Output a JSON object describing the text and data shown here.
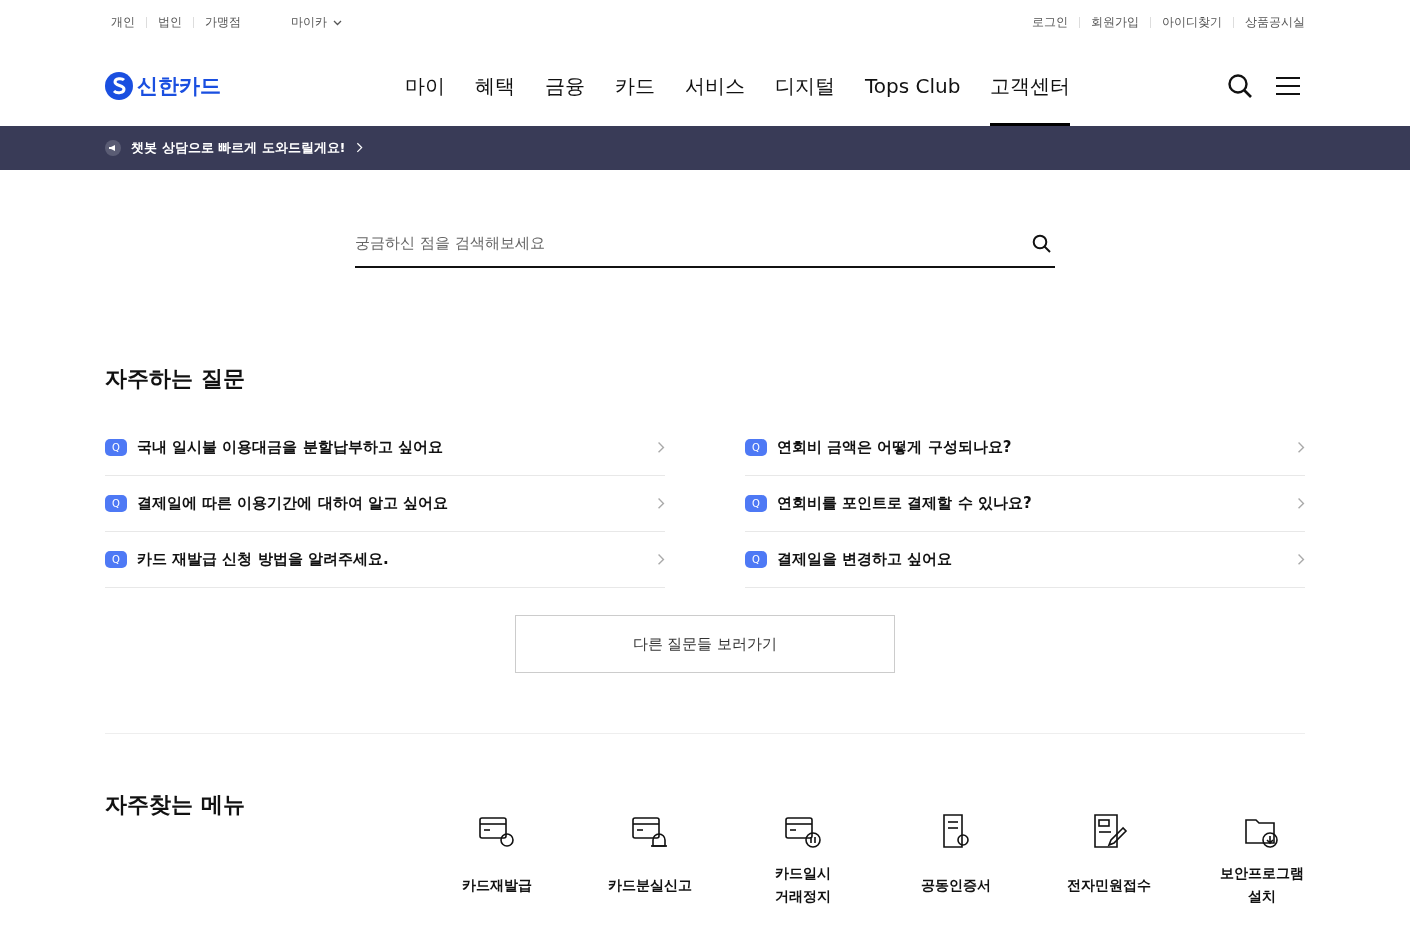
{
  "top_links_left": [
    {
      "label": "개인"
    },
    {
      "label": "법인"
    },
    {
      "label": "가맹점"
    }
  ],
  "mycar": {
    "label": "마이카"
  },
  "top_links_right": [
    {
      "label": "로그인"
    },
    {
      "label": "회원가입"
    },
    {
      "label": "아이디찾기"
    },
    {
      "label": "상품공시실"
    }
  ],
  "logo": {
    "text": "신한카드"
  },
  "nav": [
    {
      "label": "마이",
      "selected": false
    },
    {
      "label": "혜택",
      "selected": false
    },
    {
      "label": "금융",
      "selected": false
    },
    {
      "label": "카드",
      "selected": false
    },
    {
      "label": "서비스",
      "selected": false
    },
    {
      "label": "디지털",
      "selected": false
    },
    {
      "label": "Tops Club",
      "selected": false
    },
    {
      "label": "고객센터",
      "selected": true
    }
  ],
  "banner": {
    "text": "챗봇 상담으로 빠르게 도와드릴게요!"
  },
  "search": {
    "placeholder": "궁금하신 점을 검색해보세요"
  },
  "faq": {
    "title": "자주하는 질문",
    "items": [
      {
        "badge": "Q",
        "text": "국내 일시불 이용대금을 분할납부하고 싶어요"
      },
      {
        "badge": "Q",
        "text": "연회비 금액은 어떻게 구성되나요?"
      },
      {
        "badge": "Q",
        "text": "결제일에 따른 이용기간에 대하여 알고 싶어요"
      },
      {
        "badge": "Q",
        "text": "연회비를 포인트로 결제할 수 있나요?"
      },
      {
        "badge": "Q",
        "text": "카드 재발급 신청 방법을 알려주세요."
      },
      {
        "badge": "Q",
        "text": "결제일을 변경하고 싶어요"
      }
    ],
    "more_button": "다른 질문들 보러가기"
  },
  "menu": {
    "title": "자주찾는 메뉴",
    "items": [
      {
        "label": "카드재발급",
        "kind": "reissue"
      },
      {
        "label": "카드분실신고",
        "kind": "lost"
      },
      {
        "label": "카드일시 거래정지",
        "kind": "pause"
      },
      {
        "label": "공동인증서",
        "kind": "cert"
      },
      {
        "label": "전자민원접수",
        "kind": "complaint"
      },
      {
        "label": "보안프로그램 설치",
        "kind": "security"
      }
    ]
  }
}
